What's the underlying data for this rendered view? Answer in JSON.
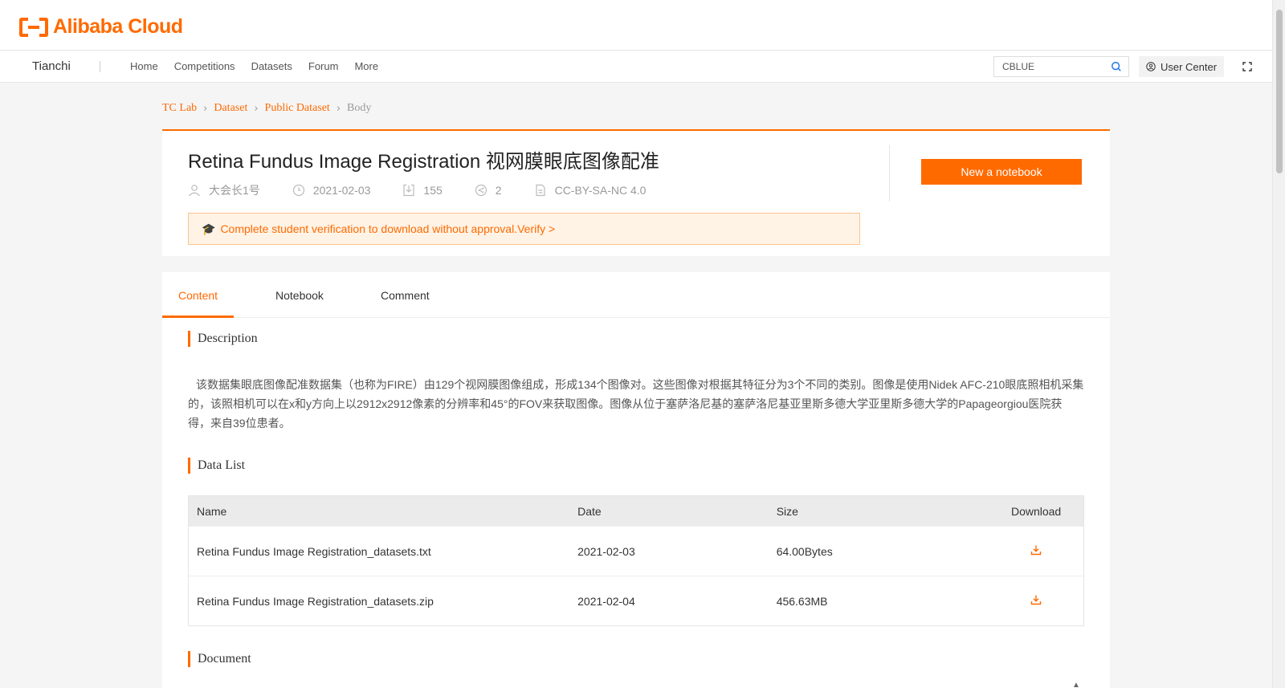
{
  "brand": {
    "logo_text": "Alibaba Cloud"
  },
  "nav": {
    "brand": "Tianchi",
    "links": [
      "Home",
      "Competitions",
      "Datasets",
      "Forum",
      "More"
    ],
    "search_value": "CBLUE",
    "user_center": "User Center"
  },
  "breadcrumb": [
    "TC Lab",
    "Dataset",
    "Public Dataset",
    "Body"
  ],
  "dataset": {
    "title": "Retina Fundus Image Registration 视网膜眼底图像配准",
    "author": "大会长1号",
    "date": "2021-02-03",
    "downloads": "155",
    "shares": "2",
    "license": "CC-BY-SA-NC 4.0",
    "notice_icon": "🎓",
    "notice_text": "Complete student verification to download without approval.",
    "notice_link": "Verify >",
    "new_notebook": "New a notebook"
  },
  "tabs": [
    "Content",
    "Notebook",
    "Comment"
  ],
  "sections": {
    "description_title": "Description",
    "description": "该数据集眼底图像配准数据集（也称为FIRE）由129个视网膜图像组成，形成134个图像对。这些图像对根据其特征分为3个不同的类别。图像是使用Nidek AFC-210眼底照相机采集的，该照相机可以在x和y方向上以2912x2912像素的分辨率和45°的FOV来获取图像。图像从位于塞萨洛尼基的塞萨洛尼基亚里斯多德大学亚里斯多德大学的Papageorgiou医院获得，来自39位患者。",
    "datalist_title": "Data List",
    "document_title": "Document"
  },
  "table": {
    "headers": [
      "Name",
      "Date",
      "Size",
      "Download"
    ],
    "rows": [
      {
        "name": "Retina Fundus Image Registration_datasets.txt",
        "date": "2021-02-03",
        "size": "64.00Bytes"
      },
      {
        "name": "Retina Fundus Image Registration_datasets.zip",
        "date": "2021-02-04",
        "size": "456.63MB"
      }
    ]
  },
  "colors": {
    "accent": "#ff6a00",
    "notice_bg": "#fff3e6"
  },
  "icons": [
    "search-icon",
    "user-icon",
    "expand-icon",
    "person-icon",
    "clock-icon",
    "download-icon",
    "share-icon",
    "license-icon",
    "graduation-cap-icon",
    "chevron-right-icon"
  ]
}
